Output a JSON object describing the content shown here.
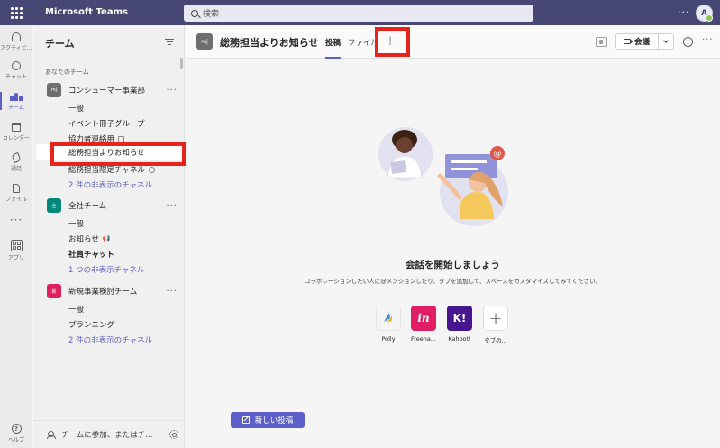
{
  "app": {
    "title": "Microsoft Teams"
  },
  "search": {
    "placeholder": "検索"
  },
  "user": {
    "initial": "A"
  },
  "rail": [
    {
      "label": "アクティビ..."
    },
    {
      "label": "チャット"
    },
    {
      "label": "チーム"
    },
    {
      "label": "カレンダー"
    },
    {
      "label": "通話"
    },
    {
      "label": "ファイル"
    },
    {
      "label": ""
    },
    {
      "label": "アプリ"
    },
    {
      "label": "ヘルプ"
    }
  ],
  "panel": {
    "title": "チーム",
    "section_label": "あなたのチーム",
    "teams": [
      {
        "avatar": "mj",
        "name": "コンシューマー事業部",
        "color": "#6e6e6e",
        "channels": [
          "一般",
          "イベント冊子グループ",
          "協力者連絡用",
          "総務担当よりお知らせ",
          "総務担当限定チャネル"
        ],
        "hidden": "2 件の非表示のチャネル"
      },
      {
        "avatar": "全",
        "name": "全社チーム",
        "color": "#00897b",
        "channels": [
          "一般",
          "お知らせ",
          "社員チャット"
        ],
        "hidden": "1 つの非表示チャネル"
      },
      {
        "avatar": "新",
        "name": "新規事業検討チーム",
        "color": "#e0215f",
        "channels": [
          "一般",
          "プランニング"
        ],
        "hidden": "2 件の非表示のチャネル"
      }
    ],
    "footer": "チームに参加、またはチ..."
  },
  "main": {
    "channel_avatar": "mj",
    "channel_title": "総務担当よりお知らせ",
    "tabs": {
      "posts": "投稿",
      "files": "ファイル",
      "add": "+"
    },
    "meet_label": "会議",
    "empty_title": "会話を開始しましょう",
    "empty_subtitle": "コラボレーションしたい人に@メンションしたり、タブを追加して、スペースをカスタマイズしてみてください。",
    "apps": [
      {
        "name": "Polly",
        "icon": "polly-icon",
        "color": "#f5f5f5"
      },
      {
        "name": "Freeha...",
        "icon": "invision-icon",
        "color": "#e01e64",
        "glyph": "in"
      },
      {
        "name": "Kahoot!",
        "icon": "kahoot-icon",
        "color": "#46178f",
        "glyph": "K!"
      },
      {
        "name": "タブの...",
        "icon": "plus-icon",
        "color": "#ffffff",
        "glyph": "+"
      }
    ],
    "new_post_label": "新しい投稿"
  },
  "colors": {
    "topbar": "#464775",
    "accent": "#5b5fc7",
    "highlight": "#e8241a"
  }
}
